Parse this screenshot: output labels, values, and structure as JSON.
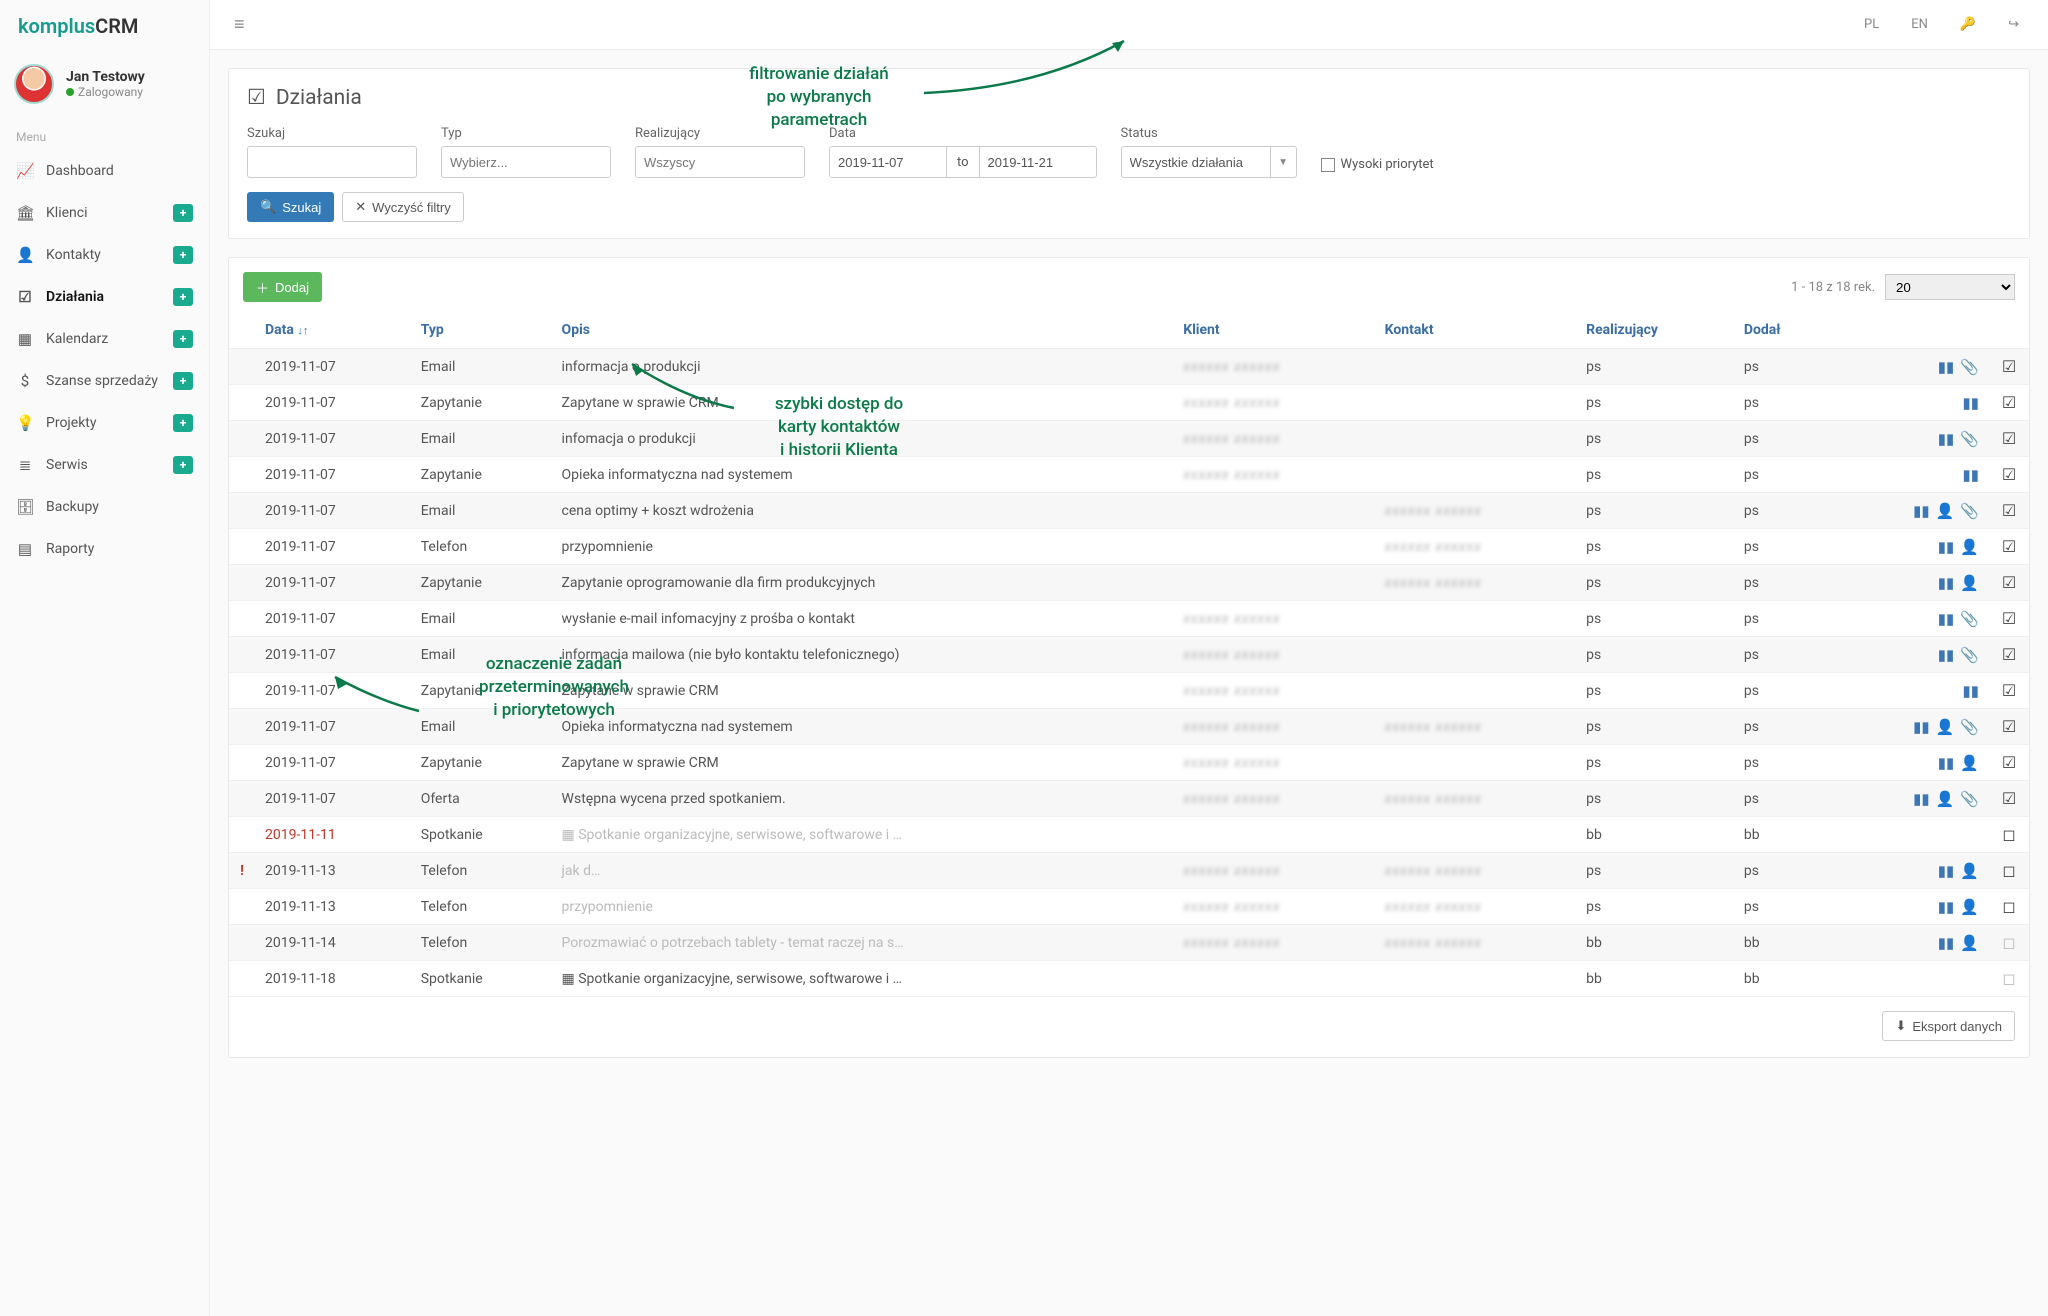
{
  "brand": {
    "part1": "komplus",
    "part2": "CRM"
  },
  "user": {
    "name": "Jan Testowy",
    "status": "Zalogowany"
  },
  "sidebar": {
    "menu_label": "Menu",
    "items": [
      {
        "icon": "📈",
        "label": "Dashboard",
        "badge": false
      },
      {
        "icon": "🏛",
        "label": "Klienci",
        "badge": true
      },
      {
        "icon": "👤",
        "label": "Kontakty",
        "badge": true
      },
      {
        "icon": "☑",
        "label": "Działania",
        "badge": true,
        "active": true
      },
      {
        "icon": "▦",
        "label": "Kalendarz",
        "badge": true
      },
      {
        "icon": "$",
        "label": "Szanse sprzedaży",
        "badge": true
      },
      {
        "icon": "💡",
        "label": "Projekty",
        "badge": true
      },
      {
        "icon": "≣",
        "label": "Serwis",
        "badge": true
      },
      {
        "icon": "🗄",
        "label": "Backupy",
        "badge": false
      },
      {
        "icon": "▤",
        "label": "Raporty",
        "badge": false
      }
    ]
  },
  "topbar": {
    "lang_pl": "PL",
    "lang_en": "EN"
  },
  "page": {
    "title": "Działania",
    "title_icon": "☑"
  },
  "filters": {
    "search_label": "Szukaj",
    "type_label": "Typ",
    "type_placeholder": "Wybierz...",
    "assignee_label": "Realizujący",
    "assignee_placeholder": "Wszyscy",
    "date_label": "Data",
    "date_from": "2019-11-07",
    "date_sep": "to",
    "date_to": "2019-11-21",
    "status_label": "Status",
    "status_value": "Wszystkie działania",
    "high_priority": "Wysoki priorytet",
    "search_btn": "Szukaj",
    "clear_btn": "Wyczyść filtry"
  },
  "table": {
    "add_btn": "Dodaj",
    "record_info": "1 - 18 z 18 rek.",
    "page_size": "20",
    "export_btn": "Eksport danych",
    "headers": {
      "date": "Data",
      "type": "Typ",
      "desc": "Opis",
      "client": "Klient",
      "contact": "Kontakt",
      "assignee": "Realizujący",
      "added": "Dodał"
    },
    "rows": [
      {
        "date": "2019-11-07",
        "type": "Email",
        "desc": "informacja o produkcji",
        "client": "~",
        "contact": "",
        "ass": "ps",
        "add": "ps",
        "icons": [
          "chart",
          "clip"
        ],
        "chk": "done"
      },
      {
        "date": "2019-11-07",
        "type": "Zapytanie",
        "desc": "Zapytane w sprawie CRM",
        "client": "~",
        "contact": "",
        "ass": "ps",
        "add": "ps",
        "icons": [
          "chart"
        ],
        "chk": "done"
      },
      {
        "date": "2019-11-07",
        "type": "Email",
        "desc": "infomacja o produkcji",
        "client": "~",
        "contact": "",
        "ass": "ps",
        "add": "ps",
        "icons": [
          "chart",
          "clip"
        ],
        "chk": "done"
      },
      {
        "date": "2019-11-07",
        "type": "Zapytanie",
        "desc": "Opieka informatyczna nad systemem",
        "client": "~",
        "contact": "",
        "ass": "ps",
        "add": "ps",
        "icons": [
          "chart"
        ],
        "chk": "done"
      },
      {
        "date": "2019-11-07",
        "type": "Email",
        "desc": "cena optimy + koszt wdrożenia",
        "client": "",
        "contact": "~",
        "ass": "ps",
        "add": "ps",
        "icons": [
          "chart",
          "person",
          "clip"
        ],
        "chk": "done"
      },
      {
        "date": "2019-11-07",
        "type": "Telefon",
        "desc": "przypomnienie",
        "client": "",
        "contact": "~",
        "ass": "ps",
        "add": "ps",
        "icons": [
          "chart",
          "person"
        ],
        "chk": "done"
      },
      {
        "date": "2019-11-07",
        "type": "Zapytanie",
        "desc": "Zapytanie oprogramowanie dla firm produkcyjnych",
        "client": "",
        "contact": "~",
        "ass": "ps",
        "add": "ps",
        "icons": [
          "chart",
          "person"
        ],
        "chk": "done"
      },
      {
        "date": "2019-11-07",
        "type": "Email",
        "desc": "wysłanie e-mail infomacyjny z prośba o kontakt",
        "client": "~",
        "contact": "",
        "ass": "ps",
        "add": "ps",
        "icons": [
          "chart",
          "clip"
        ],
        "chk": "done"
      },
      {
        "date": "2019-11-07",
        "type": "Email",
        "desc": "informacja mailowa (nie było kontaktu telefonicznego)",
        "client": "~",
        "contact": "",
        "ass": "ps",
        "add": "ps",
        "icons": [
          "chart",
          "clip"
        ],
        "chk": "done"
      },
      {
        "date": "2019-11-07",
        "type": "Zapytanie",
        "desc": "Zapytane w sprawie CRM",
        "client": "~",
        "contact": "",
        "ass": "ps",
        "add": "ps",
        "icons": [
          "chart"
        ],
        "chk": "done"
      },
      {
        "date": "2019-11-07",
        "type": "Email",
        "desc": "Opieka informatyczna nad systemem",
        "client": "~",
        "contact": "~",
        "ass": "ps",
        "add": "ps",
        "icons": [
          "chart",
          "person",
          "clip"
        ],
        "chk": "done"
      },
      {
        "date": "2019-11-07",
        "type": "Zapytanie",
        "desc": "Zapytane w sprawie CRM",
        "client": "~",
        "contact": "",
        "ass": "ps",
        "add": "ps",
        "icons": [
          "chart",
          "person"
        ],
        "chk": "done"
      },
      {
        "date": "2019-11-07",
        "type": "Oferta",
        "desc": "Wstępna wycena przed spotkaniem.",
        "client": "~",
        "contact": "~",
        "ass": "ps",
        "add": "ps",
        "icons": [
          "chart",
          "person",
          "clip"
        ],
        "chk": "done"
      },
      {
        "date": "2019-11-11",
        "type": "Spotkanie",
        "desc": "▦ Spotkanie organizacyjne, serwisowe, softwarowe i …",
        "client": "",
        "contact": "",
        "ass": "bb",
        "add": "bb",
        "icons": [],
        "chk": "open",
        "red": true,
        "muted": true
      },
      {
        "date": "2019-11-13",
        "type": "Telefon",
        "desc": "jak d…",
        "client": "~",
        "contact": "~",
        "ass": "ps",
        "add": "ps",
        "icons": [
          "chart",
          "person"
        ],
        "chk": "open",
        "flag": true,
        "muted": true
      },
      {
        "date": "2019-11-13",
        "type": "Telefon",
        "desc": "przypomnienie",
        "client": "~",
        "contact": "~",
        "ass": "ps",
        "add": "ps",
        "icons": [
          "chart",
          "person"
        ],
        "chk": "open",
        "muted": true
      },
      {
        "date": "2019-11-14",
        "type": "Telefon",
        "desc": "Porozmawiać o potrzebach tablety - temat raczej na s…",
        "client": "~",
        "contact": "~",
        "ass": "bb",
        "add": "bb",
        "icons": [
          "chart",
          "person"
        ],
        "chk": "grey",
        "muted": true
      },
      {
        "date": "2019-11-18",
        "type": "Spotkanie",
        "desc": "▦ Spotkanie organizacyjne, serwisowe, softwarowe i …",
        "client": "",
        "contact": "",
        "ass": "bb",
        "add": "bb",
        "icons": [],
        "chk": "grey"
      }
    ]
  },
  "annotations": {
    "a1": "filtrowanie działań\npo wybranych\nparametrach",
    "a2": "szybki dostęp do\nkarty kontaktów\ni historii Klienta",
    "a3": "oznaczenie zadań\nprzeterminowanych\ni priorytetowych"
  }
}
